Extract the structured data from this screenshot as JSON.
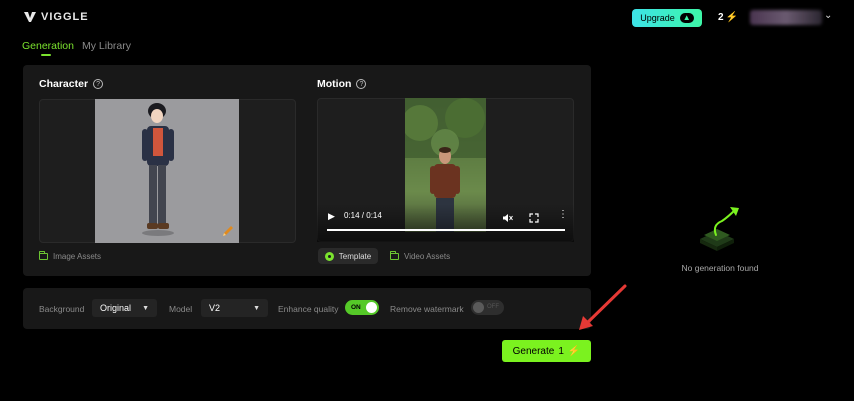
{
  "header": {
    "brand": "VIGGLE",
    "upgrade_label": "Upgrade",
    "credits": "2"
  },
  "tabs": [
    {
      "label": "Generation",
      "active": true
    },
    {
      "label": "My Library",
      "active": false
    }
  ],
  "character": {
    "title": "Character",
    "assets_link": "Image Assets"
  },
  "motion": {
    "title": "Motion",
    "video_time": "0:14 / 0:14",
    "template_label": "Template",
    "assets_link": "Video Assets"
  },
  "settings": {
    "background_label": "Background",
    "background_value": "Original",
    "model_label": "Model",
    "model_value": "V2",
    "enhance_label": "Enhance quality",
    "enhance_state": "ON",
    "watermark_label": "Remove watermark",
    "watermark_state": "OFF"
  },
  "generate": {
    "label": "Generate",
    "cost": "1"
  },
  "empty_state": {
    "text": "No generation found"
  },
  "colors": {
    "accent": "#7bf21f",
    "panel": "#181818",
    "background": "#000000"
  }
}
